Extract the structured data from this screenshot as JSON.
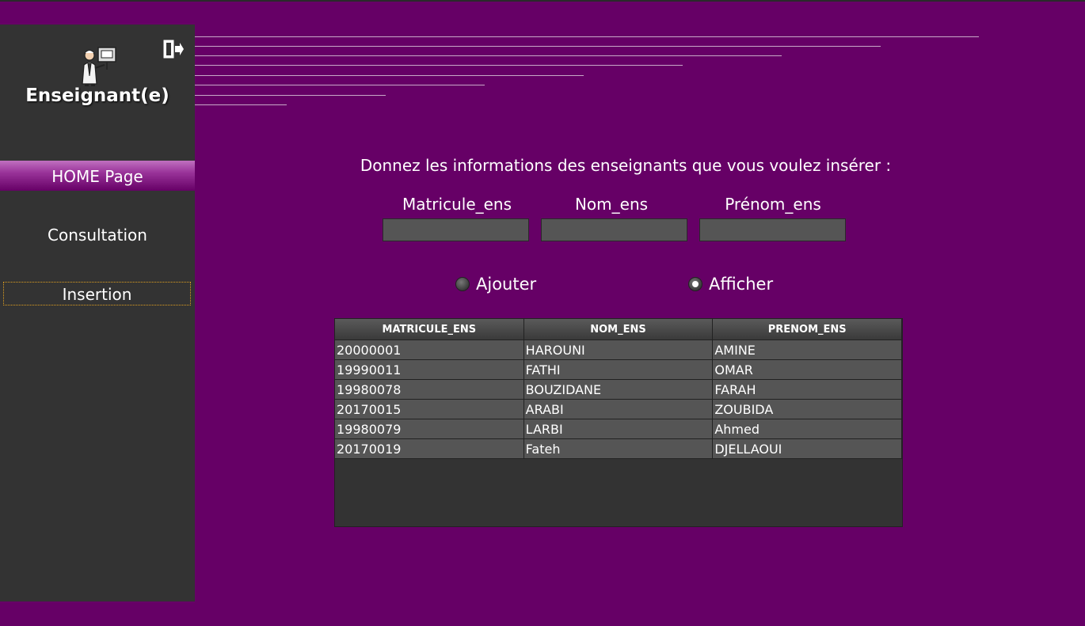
{
  "sidebar": {
    "role_title": "Enseignant(e)",
    "nav": [
      {
        "label": "HOME Page"
      },
      {
        "label": "Consultation"
      },
      {
        "label": "Insertion"
      }
    ],
    "icons": {
      "avatar": "teacher-icon",
      "logout": "logout-icon"
    }
  },
  "form": {
    "prompt": "Donnez les informations des enseignants que vous voulez insérer :",
    "fields": [
      {
        "label": "Matricule_ens",
        "value": ""
      },
      {
        "label": "Nom_ens",
        "value": ""
      },
      {
        "label": "Prénom_ens",
        "value": ""
      }
    ],
    "options": [
      {
        "label": "Ajouter",
        "checked": false
      },
      {
        "label": "Afficher",
        "checked": true
      }
    ]
  },
  "table": {
    "columns": [
      "MATRICULE_ENS",
      "NOM_ENS",
      "PRENOM_ENS"
    ],
    "rows": [
      [
        "20000001",
        "HAROUNI",
        "AMINE"
      ],
      [
        "19990011",
        "FATHI",
        "OMAR"
      ],
      [
        "19980078",
        "BOUZIDANE",
        "FARAH"
      ],
      [
        "20170015",
        "ARABI",
        "ZOUBIDA"
      ],
      [
        "19980079",
        "LARBI",
        "Ahmed"
      ],
      [
        "20170019",
        "Fateh",
        "DJELLAOUI"
      ]
    ]
  },
  "colors": {
    "background": "#660066",
    "sidebar": "#333333",
    "accent": "#993399"
  }
}
